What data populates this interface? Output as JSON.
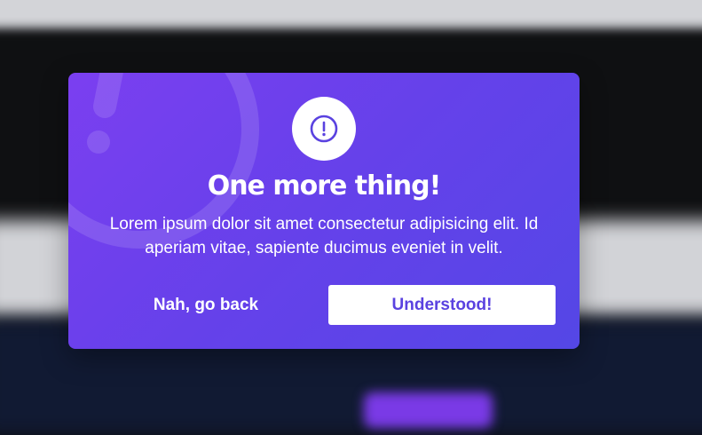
{
  "colors": {
    "modal_gradient_start": "#7b3ff0",
    "modal_gradient_end": "#5447e6",
    "primary_button_bg": "#ffffff",
    "primary_button_text": "#5a42e0",
    "icon_color": "#5a42e0"
  },
  "modal": {
    "icon": "alert-circle-icon",
    "title": "One more thing!",
    "message": "Lorem ipsum dolor sit amet consectetur adipisicing elit. Id aperiam vitae, sapiente ducimus eveniet in velit.",
    "secondary_button": "Nah, go back",
    "primary_button": "Understood!"
  }
}
